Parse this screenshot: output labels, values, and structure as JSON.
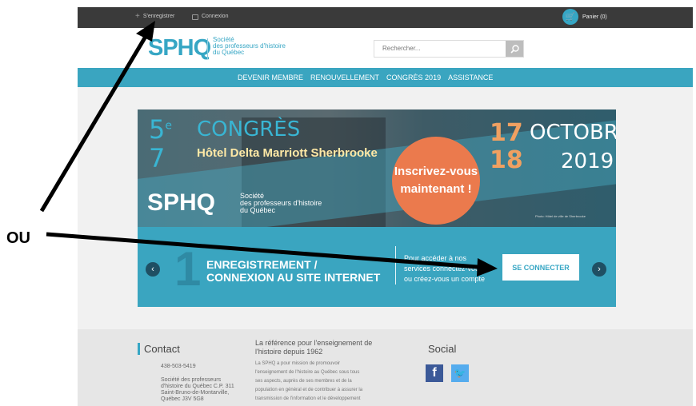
{
  "topbar": {
    "register": "S'enregistrer",
    "login": "Connexion",
    "cart": "Panier (0)"
  },
  "header": {
    "logo_text": "SPHQ",
    "logo_name": [
      "Société",
      "des professeurs d'histoire",
      "du Québec"
    ],
    "search_placeholder": "Rechercher..."
  },
  "nav": {
    "items": [
      "DEVENIR MEMBRE",
      "RENOUVELLEMENT",
      "CONGRÈS 2019",
      "ASSISTANCE"
    ]
  },
  "hero": {
    "edition": "5",
    "edition_sup": "e",
    "edition_next": "7",
    "title": "CONGRÈS",
    "venue": "Hôtel Delta Marriott Sherbrooke",
    "logo_text": "SPHQ",
    "logo_name": [
      "Société",
      "des professeurs d'histoire",
      "du Québec"
    ],
    "cta": [
      "Inscrivez-vous",
      "maintenant !"
    ],
    "day1": "17",
    "day2": "18",
    "month": "OCTOBRE",
    "year": "2019",
    "credit": "Photo: Hôtel de ville de Sherbrooke"
  },
  "step": {
    "number": "1",
    "title_line1": "ENREGISTREMENT /",
    "title_line2": "CONNEXION AU SITE INTERNET",
    "text": [
      "Pour accéder à nos",
      "services connectez-vous",
      "ou créez-vous un compte"
    ],
    "button": "SE CONNECTER",
    "prev_icon": "‹",
    "next_icon": "›"
  },
  "footer": {
    "contact_title": "Contact",
    "phone": "438-503-5419",
    "address": [
      "Société des professeurs",
      "d'histoire du Québec C.P. 311",
      "Saint-Bruno-de-Montarville,",
      "Québec J3V 5G8"
    ],
    "ref_title": "La référence pour l'enseignement de l'histoire depuis 1962",
    "ref_body": [
      "La SPHQ a pour mission de promouvoir",
      "l'enseignement de l'histoire au Québec sous tous",
      "ses aspects, auprès de ses membres et de la",
      "population en général et de contribuer à assurer la",
      "transmission de l'information et le développement"
    ],
    "social_title": "Social"
  },
  "annotation": {
    "ou": "OU"
  },
  "colors": {
    "brand": "#36a6c4",
    "nav": "#3aa5c0",
    "topbar": "#3a3a3a",
    "cta": "#eb7a4d"
  }
}
